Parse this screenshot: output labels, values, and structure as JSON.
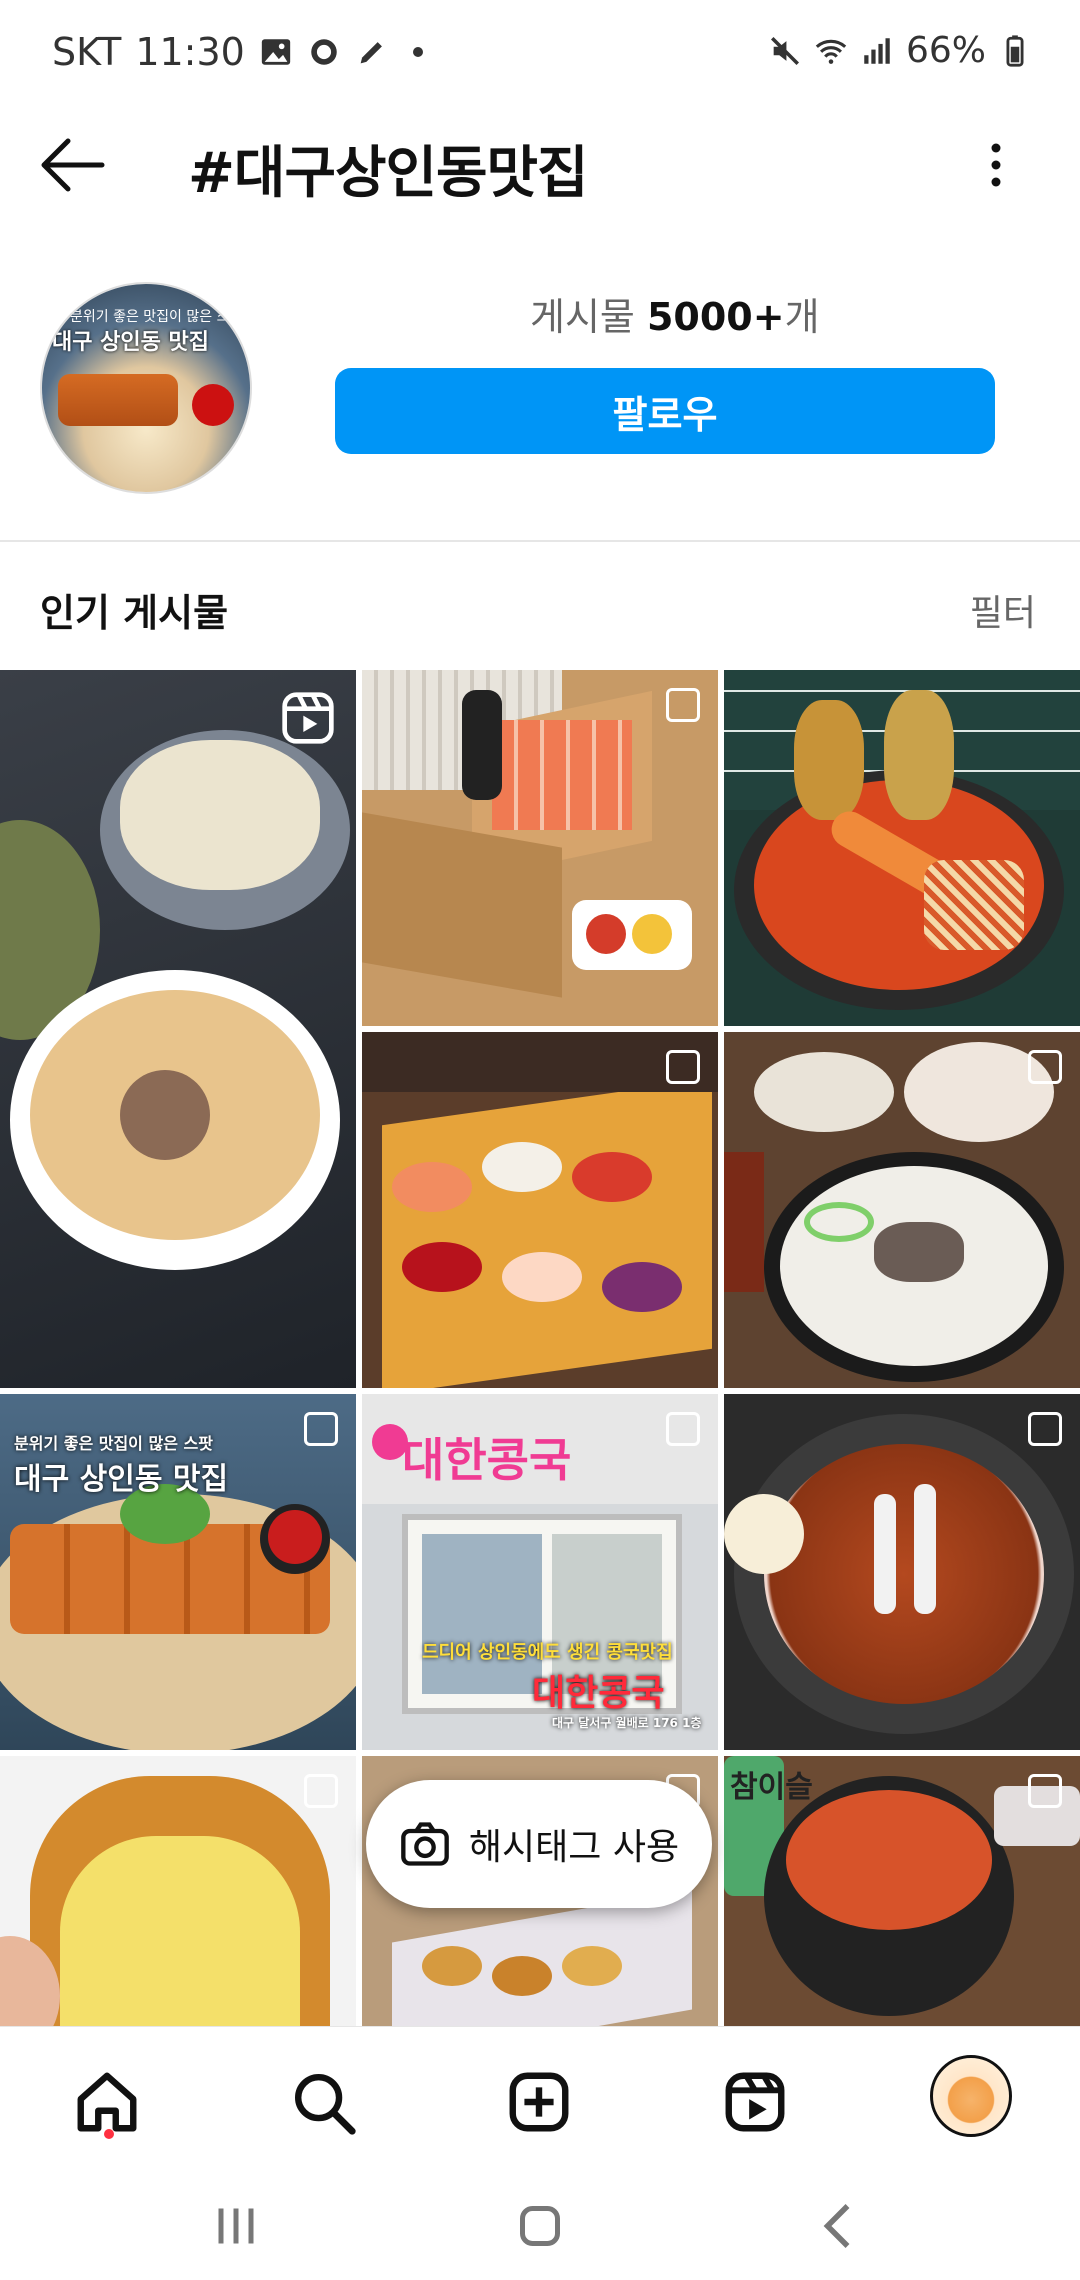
{
  "status_bar": {
    "carrier": "SKT",
    "time": "11:30",
    "battery": "66%"
  },
  "header": {
    "title": "#대구상인동맛집"
  },
  "profile": {
    "avatar_caption": "분위기 좋은 맛집이 많은 스팟",
    "avatar_title": "대구 상인동 맛집",
    "posts_label": "게시물",
    "posts_count": "5000+",
    "posts_suffix": "개",
    "follow_label": "팔로우"
  },
  "popular": {
    "heading": "인기 게시물",
    "filter_label": "필터"
  },
  "grid": {
    "post7_caption": "분위기 좋은 맛집이 많은 스팟",
    "post7_title": "대구 상인동 맛집",
    "post8_sign": "대한콩국",
    "post8_caption": "드디어 상인동에도 생긴 콩국맛집",
    "post8_title": "대한콩국",
    "post8_address": "대구 달서구 월배로 176 1층",
    "post12_label": "참이슬"
  },
  "hashtag_button": {
    "label": "해시태그 사용"
  },
  "bottom_nav": {
    "items": [
      "home-icon",
      "search-icon",
      "create-icon",
      "reels-icon",
      "profile-avatar"
    ]
  },
  "colors": {
    "accent": "#0095f6",
    "notification_dot": "#ff3040"
  }
}
